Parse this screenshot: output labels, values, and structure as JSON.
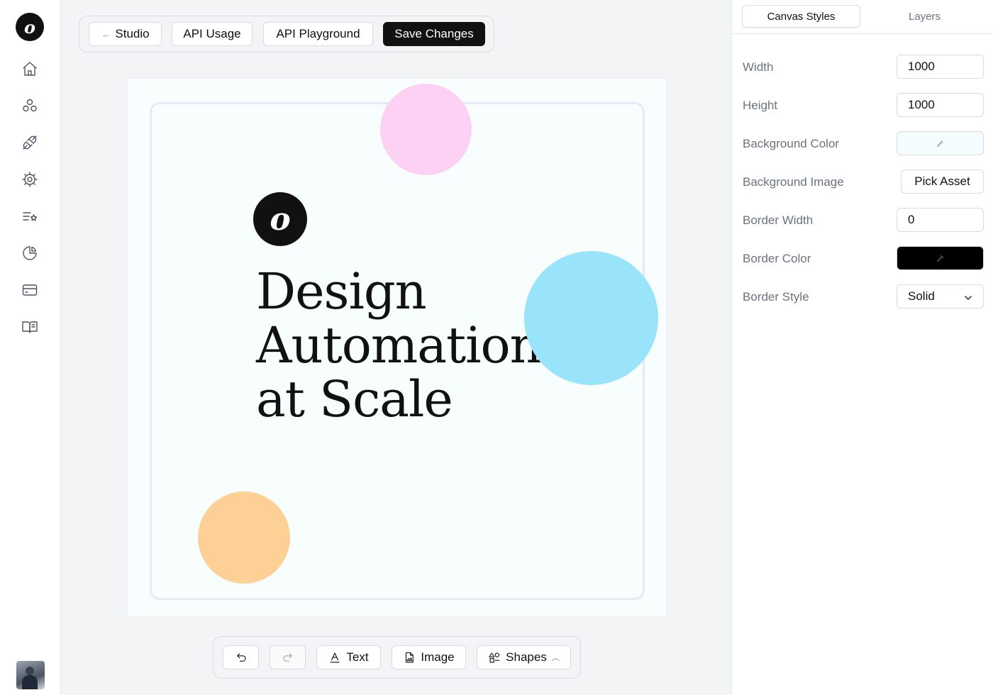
{
  "sidebar": {
    "logo_glyph": "o",
    "items": [
      {
        "name": "home",
        "icon": "home-icon"
      },
      {
        "name": "components",
        "icon": "circles-icon"
      },
      {
        "name": "integrations",
        "icon": "plug-icon"
      },
      {
        "name": "settings",
        "icon": "gear-icon"
      },
      {
        "name": "favorites",
        "icon": "list-star-icon"
      },
      {
        "name": "analytics",
        "icon": "pie-chart-icon"
      },
      {
        "name": "billing",
        "icon": "credit-card-icon"
      },
      {
        "name": "docs",
        "icon": "book-open-icon"
      }
    ],
    "avatar": "user-avatar"
  },
  "toolbar": {
    "back_label": "Studio",
    "back_icon": "arrow-left-icon",
    "api_usage_label": "API Usage",
    "api_playground_label": "API Playground",
    "save_label": "Save Changes"
  },
  "canvas": {
    "background_color": "#f8fdfd",
    "logo_glyph": "o",
    "headline_lines": [
      "Design",
      "Automation",
      "at Scale"
    ],
    "shape_colors": {
      "pink": "#fdd1f3",
      "blue": "#99e3fb",
      "orange": "#fdd195"
    }
  },
  "bottom_tools": {
    "undo_icon": "undo-icon",
    "redo_icon": "redo-icon",
    "text_label": "Text",
    "image_label": "Image",
    "shapes_label": "Shapes"
  },
  "panel": {
    "tabs": [
      {
        "label": "Canvas Styles",
        "active": true
      },
      {
        "label": "Layers",
        "active": false
      }
    ],
    "fields": {
      "width": {
        "label": "Width",
        "value": "1000"
      },
      "height": {
        "label": "Height",
        "value": "1000"
      },
      "background_color": {
        "label": "Background Color",
        "color": "#f5fcfd"
      },
      "background_image": {
        "label": "Background Image",
        "button": "Pick Asset"
      },
      "border_width": {
        "label": "Border Width",
        "value": "0"
      },
      "border_color": {
        "label": "Border Color",
        "color": "#000000"
      },
      "border_style": {
        "label": "Border Style",
        "value": "Solid"
      }
    }
  }
}
